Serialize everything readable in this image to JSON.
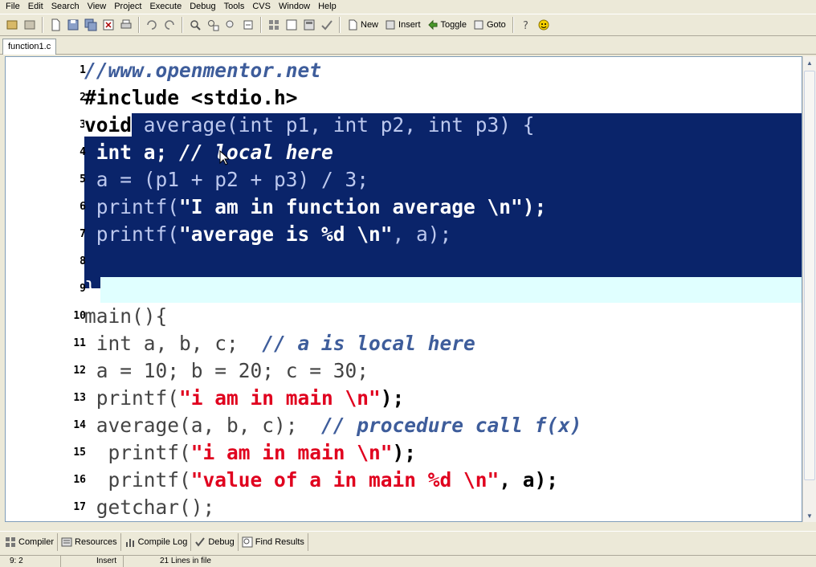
{
  "menu": [
    "File",
    "Edit",
    "Search",
    "View",
    "Project",
    "Execute",
    "Debug",
    "Tools",
    "CVS",
    "Window",
    "Help"
  ],
  "toolbar": {
    "new_label": "New",
    "insert_label": "Insert",
    "toggle_label": "Toggle",
    "goto_label": "Goto"
  },
  "tabs": [
    {
      "label": "function1.c"
    }
  ],
  "line_numbers": [
    "1",
    "2",
    "3",
    "4",
    "5",
    "6",
    "7",
    "8",
    "9",
    "10",
    "11",
    "12",
    "13",
    "14",
    "15",
    "16",
    "17"
  ],
  "code": {
    "l1": "//www.openmentor.net",
    "l2": "#include <stdio.h>",
    "l3_kw": "void",
    "l3_rest": " average(int p1, int p2, int p3) {",
    "l4_a": " int a; ",
    "l4_c": "// local here",
    "l5": " a = (p1 + p2 + p3) / 3;",
    "l6_a": " printf(",
    "l6_s": "\"I am in function average \\n\"",
    "l6_e": ");",
    "l7_a": " printf(",
    "l7_s": "\"average is %d \\n\"",
    "l7_e": ", a);",
    "l9": "}",
    "l10": "main(){",
    "l11_a": " int a, b, c;  ",
    "l11_c": "// a is local here",
    "l12": " a = 10; b = 20; c = 30;",
    "l13_a": " printf(",
    "l13_s": "\"i am in main \\n\"",
    "l13_e": ");",
    "l14_a": " average(a, b, c);  ",
    "l14_c": "// procedure call f(x)",
    "l15_a": "  printf(",
    "l15_s": "\"i am in main \\n\"",
    "l15_e": ");",
    "l16_a": "  printf(",
    "l16_s": "\"value of a in main %d \\n\"",
    "l16_e": ", a);",
    "l17": " getchar();"
  },
  "bottom_tabs": [
    "Compiler",
    "Resources",
    "Compile Log",
    "Debug",
    "Find Results"
  ],
  "status": {
    "position": "9: 2",
    "mode": "Insert",
    "lines": "21 Lines in file"
  },
  "colors": {
    "selection": "#0a246a",
    "current_line": "#e0ffff",
    "comment": "#3e5d9b",
    "string": "#e0001e"
  }
}
